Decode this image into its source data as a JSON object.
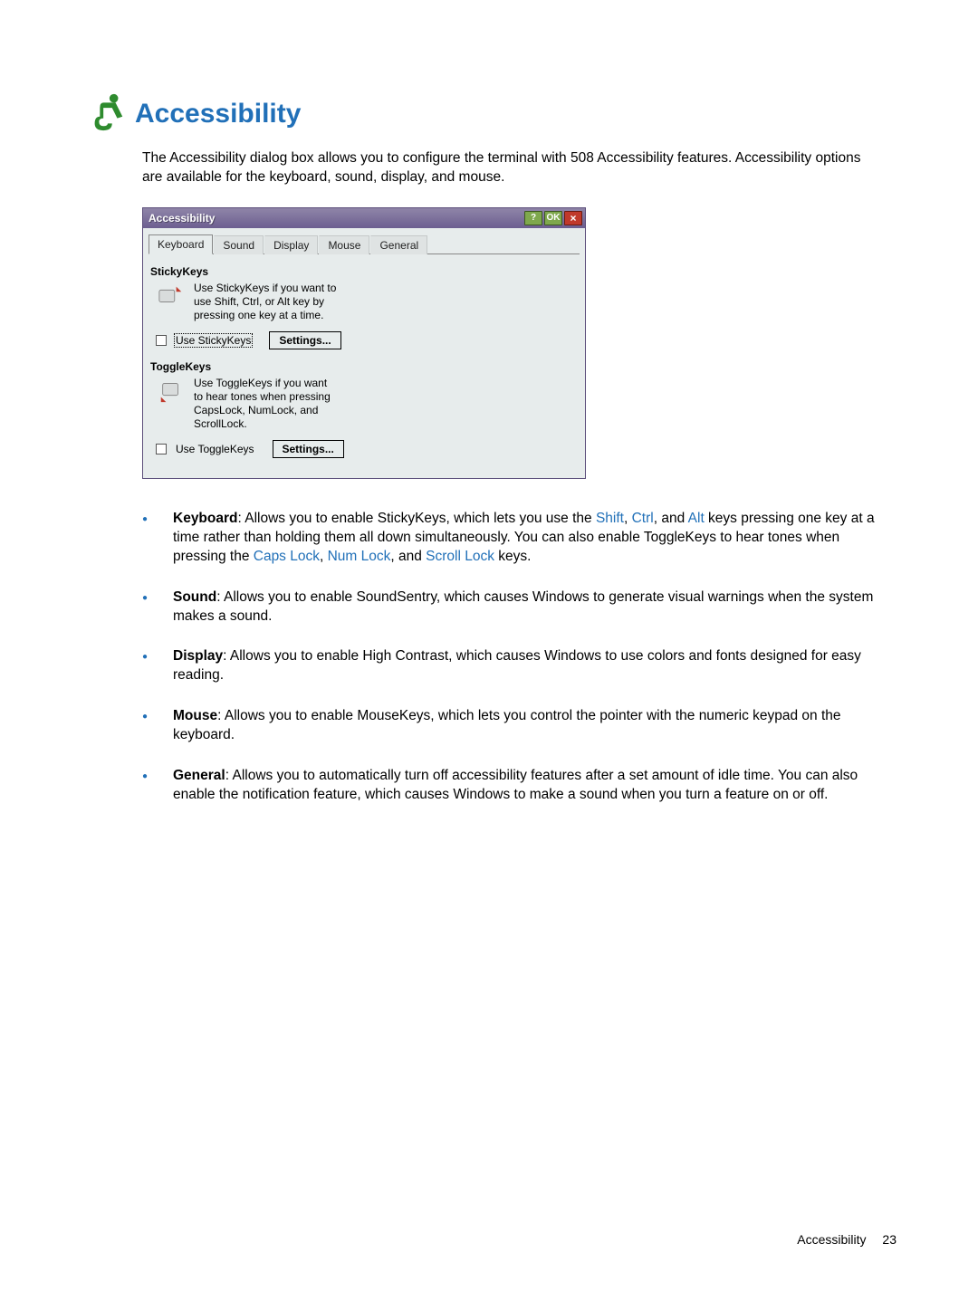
{
  "heading": "Accessibility",
  "intro": "The Accessibility dialog box allows you to configure the terminal with 508 Accessibility features. Accessibility options are available for the keyboard, sound, display, and mouse.",
  "dialog": {
    "title": "Accessibility",
    "help_btn": "?",
    "ok_btn": "OK",
    "close_btn": "×",
    "tabs": [
      {
        "label": "Keyboard",
        "active": true
      },
      {
        "label": "Sound",
        "active": false
      },
      {
        "label": "Display",
        "active": false
      },
      {
        "label": "Mouse",
        "active": false
      },
      {
        "label": "General",
        "active": false
      }
    ],
    "sticky": {
      "group_title": "StickyKeys",
      "text": "Use StickyKeys if you want to use Shift, Ctrl, or Alt key by pressing one key at a time.",
      "checkbox_label": "Use StickyKeys",
      "settings_btn": "Settings..."
    },
    "toggle": {
      "group_title": "ToggleKeys",
      "text": "Use ToggleKeys if you want to hear tones when pressing CapsLock, NumLock, and ScrollLock.",
      "checkbox_label": "Use ToggleKeys",
      "settings_btn": "Settings..."
    }
  },
  "bullets": {
    "keyboard": {
      "label": "Keyboard",
      "t1": ": Allows you to enable StickyKeys, which lets you use the ",
      "k1": "Shift",
      "c1": ", ",
      "k2": "Ctrl",
      "c2": ", and ",
      "k3": "Alt",
      "t2": " keys pressing one key at a time rather than holding them all down simultaneously. You can also enable ToggleKeys to hear tones when pressing the ",
      "k4": "Caps Lock",
      "c3": ", ",
      "k5": "Num Lock",
      "c4": ", and ",
      "k6": "Scroll Lock",
      "t3": " keys."
    },
    "sound": {
      "label": "Sound",
      "text": ": Allows you to enable SoundSentry, which causes Windows to generate visual warnings when the system makes a sound."
    },
    "display": {
      "label": "Display",
      "text": ": Allows you to enable High Contrast, which causes Windows to use colors and fonts designed for easy reading."
    },
    "mouse": {
      "label": "Mouse",
      "text": ": Allows you to enable MouseKeys, which lets you control the pointer with the numeric keypad on the keyboard."
    },
    "general": {
      "label": "General",
      "text": ": Allows you to automatically turn off accessibility features after a set amount of idle time. You can also enable the notification feature, which causes Windows to make a sound when you turn a feature on or off."
    }
  },
  "footer": {
    "section": "Accessibility",
    "page": "23"
  }
}
